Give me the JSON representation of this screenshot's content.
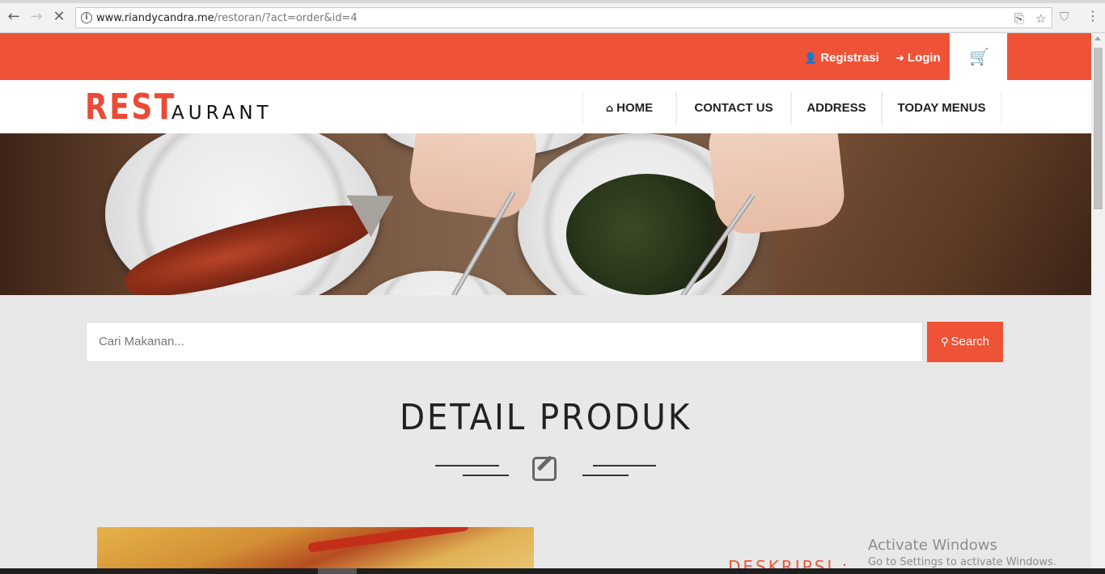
{
  "browser": {
    "back_icon": "arrow-left-icon",
    "forward_icon": "arrow-right-icon",
    "stop_icon": "close-icon",
    "url_host": "www.riandycandra.me",
    "url_path": "/restoran/?act=order&id=4",
    "translate_icon": "translate-icon",
    "star_icon": "star-icon",
    "menu_icon": "kebab-menu-icon"
  },
  "topbar": {
    "registrasi_label": "Registrasi",
    "login_label": "Login",
    "cart_icon": "cart-icon",
    "accent_color": "#ef5337"
  },
  "logo": {
    "part1": "REST",
    "part2": "AURANT"
  },
  "nav": {
    "items": [
      {
        "label": "HOME",
        "icon": "home-icon"
      },
      {
        "label": "CONTACT US"
      },
      {
        "label": "ADDRESS"
      },
      {
        "label": "TODAY MENUS"
      }
    ]
  },
  "search": {
    "placeholder": "Cari Makanan...",
    "button_label": "Search"
  },
  "section": {
    "title": "DETAIL PRODUK"
  },
  "product": {
    "description_label": "DESKRIPSI :"
  },
  "watermark": {
    "line1": "Activate Windows",
    "line2": "Go to Settings to activate Windows."
  }
}
